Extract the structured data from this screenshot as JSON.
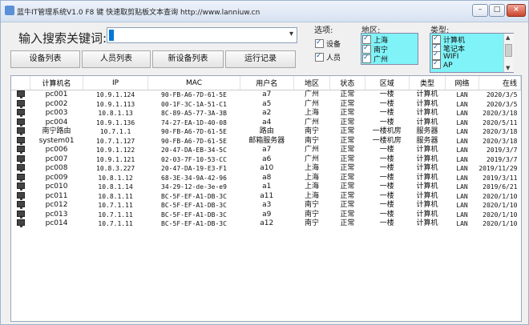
{
  "window": {
    "title": "蓝牛IT管理系统V1.0   F8 键 快速取剪贴板文本查询   http://www.lanniuw.cn",
    "controls": {
      "minimize": "–",
      "maximize": "□",
      "close": "×"
    }
  },
  "search": {
    "label": "输入搜索关键词:",
    "value": ""
  },
  "buttons": [
    "设备列表",
    "人员列表",
    "新设备列表",
    "运行记录"
  ],
  "options": {
    "label": "选项:",
    "items": [
      {
        "label": "设备",
        "checked": true
      },
      {
        "label": "人员",
        "checked": true
      }
    ]
  },
  "region": {
    "label": "地区:",
    "items": [
      {
        "label": "上海",
        "checked": true
      },
      {
        "label": "南宁",
        "checked": true
      },
      {
        "label": "广州",
        "checked": true
      }
    ]
  },
  "type_filter": {
    "label": "类型:",
    "items": [
      {
        "label": "计算机",
        "checked": true
      },
      {
        "label": "笔记本",
        "checked": true
      },
      {
        "label": "WIFI",
        "checked": true
      },
      {
        "label": "AP",
        "checked": true
      }
    ]
  },
  "table": {
    "columns": [
      "计算机名",
      "IP",
      "MAC",
      "用户名",
      "地区",
      "状态",
      "区域",
      "类型",
      "网络",
      "在线"
    ],
    "rows": [
      [
        "pc001",
        "10.9.1.124",
        "90-FB-A6-7D-61-5E",
        "a7",
        "广州",
        "正常",
        "一楼",
        "计算机",
        "LAN",
        "2020/3/5"
      ],
      [
        "pc002",
        "10.9.1.113",
        "00-1F-3C-1A-51-C1",
        "a5",
        "广州",
        "正常",
        "一楼",
        "计算机",
        "LAN",
        "2020/3/5"
      ],
      [
        "pc003",
        "10.8.1.13",
        "8C-89-A5-77-3A-3B",
        "a2",
        "上海",
        "正常",
        "一楼",
        "计算机",
        "LAN",
        "2020/3/18"
      ],
      [
        "pc004",
        "10.9.1.136",
        "74-27-EA-1D-40-08",
        "a4",
        "广州",
        "正常",
        "一楼",
        "计算机",
        "LAN",
        "2020/5/11"
      ],
      [
        "南宁路由",
        "10.7.1.1",
        "90-FB-A6-7D-61-5E",
        "路由",
        "南宁",
        "正常",
        "一楼机房",
        "服务器",
        "LAN",
        "2020/3/18"
      ],
      [
        "system01",
        "10.7.1.127",
        "90-FB-A6-7D-61-5E",
        "邮箱服务器",
        "南宁",
        "正常",
        "一楼机房",
        "服务器",
        "LAN",
        "2020/3/18"
      ],
      [
        "pc006",
        "10.9.1.122",
        "20-47-DA-EB-34-5C",
        "a7",
        "广州",
        "正常",
        "一楼",
        "计算机",
        "LAN",
        "2019/3/7"
      ],
      [
        "pc007",
        "10.9.1.121",
        "02-03-7F-10-53-CC",
        "a6",
        "广州",
        "正常",
        "一楼",
        "计算机",
        "LAN",
        "2019/3/7"
      ],
      [
        "pc008",
        "10.8.3.227",
        "20-47-DA-19-E3-F1",
        "a10",
        "上海",
        "正常",
        "一楼",
        "计算机",
        "LAN",
        "2019/11/29"
      ],
      [
        "pc009",
        "10.8.1.12",
        "68-3E-34-9A-42-96",
        "a8",
        "上海",
        "正常",
        "一楼",
        "计算机",
        "LAN",
        "2019/3/11"
      ],
      [
        "pc010",
        "10.8.1.14",
        "34-29-12-de-3e-e9",
        "a1",
        "上海",
        "正常",
        "一楼",
        "计算机",
        "LAN",
        "2019/6/21"
      ],
      [
        "pc011",
        "10.8.1.11",
        "BC-5F-EF-A1-DB-3C",
        "a11",
        "上海",
        "正常",
        "一楼",
        "计算机",
        "LAN",
        "2020/1/10"
      ],
      [
        "pc012",
        "10.7.1.11",
        "BC-5F-EF-A1-DB-3C",
        "a3",
        "南宁",
        "正常",
        "一楼",
        "计算机",
        "LAN",
        "2020/1/10"
      ],
      [
        "pc013",
        "10.7.1.11",
        "BC-5F-EF-A1-DB-3C",
        "a9",
        "南宁",
        "正常",
        "一楼",
        "计算机",
        "LAN",
        "2020/1/10"
      ],
      [
        "pc014",
        "10.7.1.11",
        "BC-5F-EF-A1-DB-3C",
        "a12",
        "南宁",
        "正常",
        "一楼",
        "计算机",
        "LAN",
        "2020/1/10"
      ]
    ]
  },
  "colors": {
    "caret": "#0078d7",
    "filter_highlight": "#7ff3f7"
  },
  "icons": {
    "row_icon": "monitor-icon",
    "app_icon": "app-logo-icon"
  }
}
